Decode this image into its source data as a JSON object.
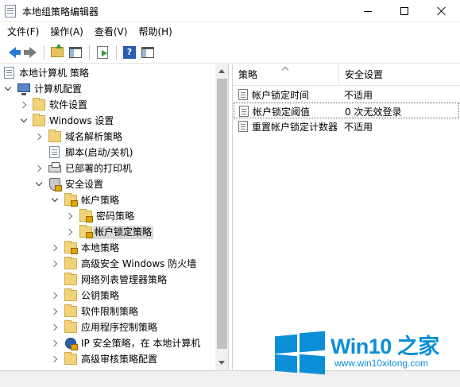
{
  "window": {
    "title": "本地组策略编辑器"
  },
  "menu": {
    "items": [
      "文件(F)",
      "操作(A)",
      "查看(V)",
      "帮助(H)"
    ]
  },
  "toolbar": {
    "icons": [
      "back-arrow-icon",
      "forward-arrow-icon",
      "up-folder-icon",
      "show-hide-tree-icon",
      "export-list-icon",
      "help-icon",
      "properties-icon"
    ],
    "help_glyph": "?"
  },
  "tree": {
    "root": "本地计算机 策略",
    "items": [
      {
        "label": "计算机配置"
      },
      {
        "label": "软件设置"
      },
      {
        "label": "Windows 设置"
      },
      {
        "label": "域名解析策略"
      },
      {
        "label": "脚本(启动/关机)"
      },
      {
        "label": "已部署的打印机"
      },
      {
        "label": "安全设置"
      },
      {
        "label": "帐户策略"
      },
      {
        "label": "密码策略"
      },
      {
        "label": "帐户锁定策略"
      },
      {
        "label": "本地策略"
      },
      {
        "label": "高级安全 Windows 防火墙"
      },
      {
        "label": "网络列表管理器策略"
      },
      {
        "label": "公钥策略"
      },
      {
        "label": "软件限制策略"
      },
      {
        "label": "应用程序控制策略"
      },
      {
        "label": "IP 安全策略，在 本地计算机"
      },
      {
        "label": "高级审核策略配置"
      }
    ]
  },
  "list": {
    "columns": {
      "policy": "策略",
      "setting": "安全设置"
    },
    "rows": [
      {
        "name": "帐户锁定时间",
        "value": "不适用"
      },
      {
        "name": "帐户锁定阈值",
        "value": "0 次无效登录"
      },
      {
        "name": "重置帐户锁定计数器",
        "value": "不适用"
      }
    ]
  },
  "watermark": {
    "title": "Win10 之家",
    "url": "www.win10xitong.com",
    "color": "#0b8fd8"
  }
}
